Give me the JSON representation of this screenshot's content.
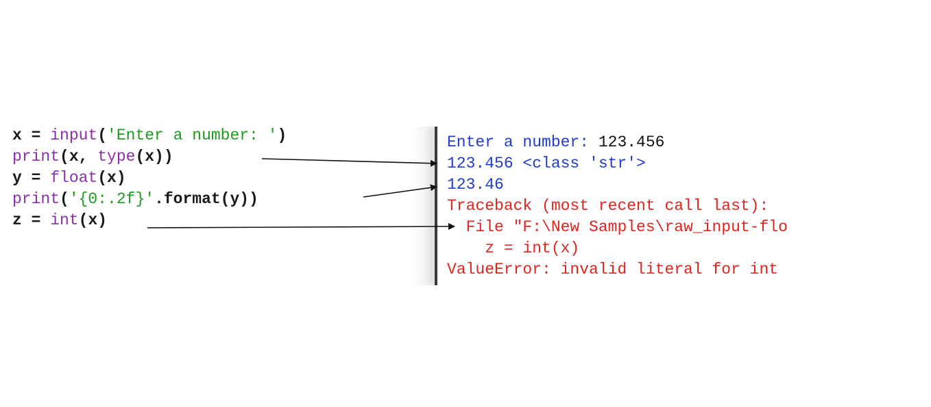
{
  "code": {
    "line1": {
      "a": "x = ",
      "b": "input",
      "c": "(",
      "d": "'Enter a number: '",
      "e": ")"
    },
    "line2": {
      "a": "print",
      "b": "(x, ",
      "c": "type",
      "d": "(x))"
    },
    "line3": {
      "a": "y = ",
      "b": "float",
      "c": "(x)"
    },
    "line4": {
      "a": "print",
      "b": "(",
      "c": "'{0:.2f}'",
      "d": ".format(y))"
    },
    "line5": {
      "a": "z = ",
      "b": "int",
      "c": "(x)"
    }
  },
  "console": {
    "prompt": "Enter a number: ",
    "user_input": "123.456",
    "out1": "123.456 <class 'str'>",
    "out2": "123.46",
    "tb_header": "Traceback (most recent call last):",
    "tb_file": "  File \"F:\\New Samples\\raw_input-flo",
    "tb_code": "    z = int(x)",
    "tb_error": "ValueError: invalid literal for int"
  },
  "colors": {
    "keyword": "#8b2fa8",
    "string": "#1f9a1f",
    "output": "#1e3cd4",
    "error": "#e0241f"
  }
}
